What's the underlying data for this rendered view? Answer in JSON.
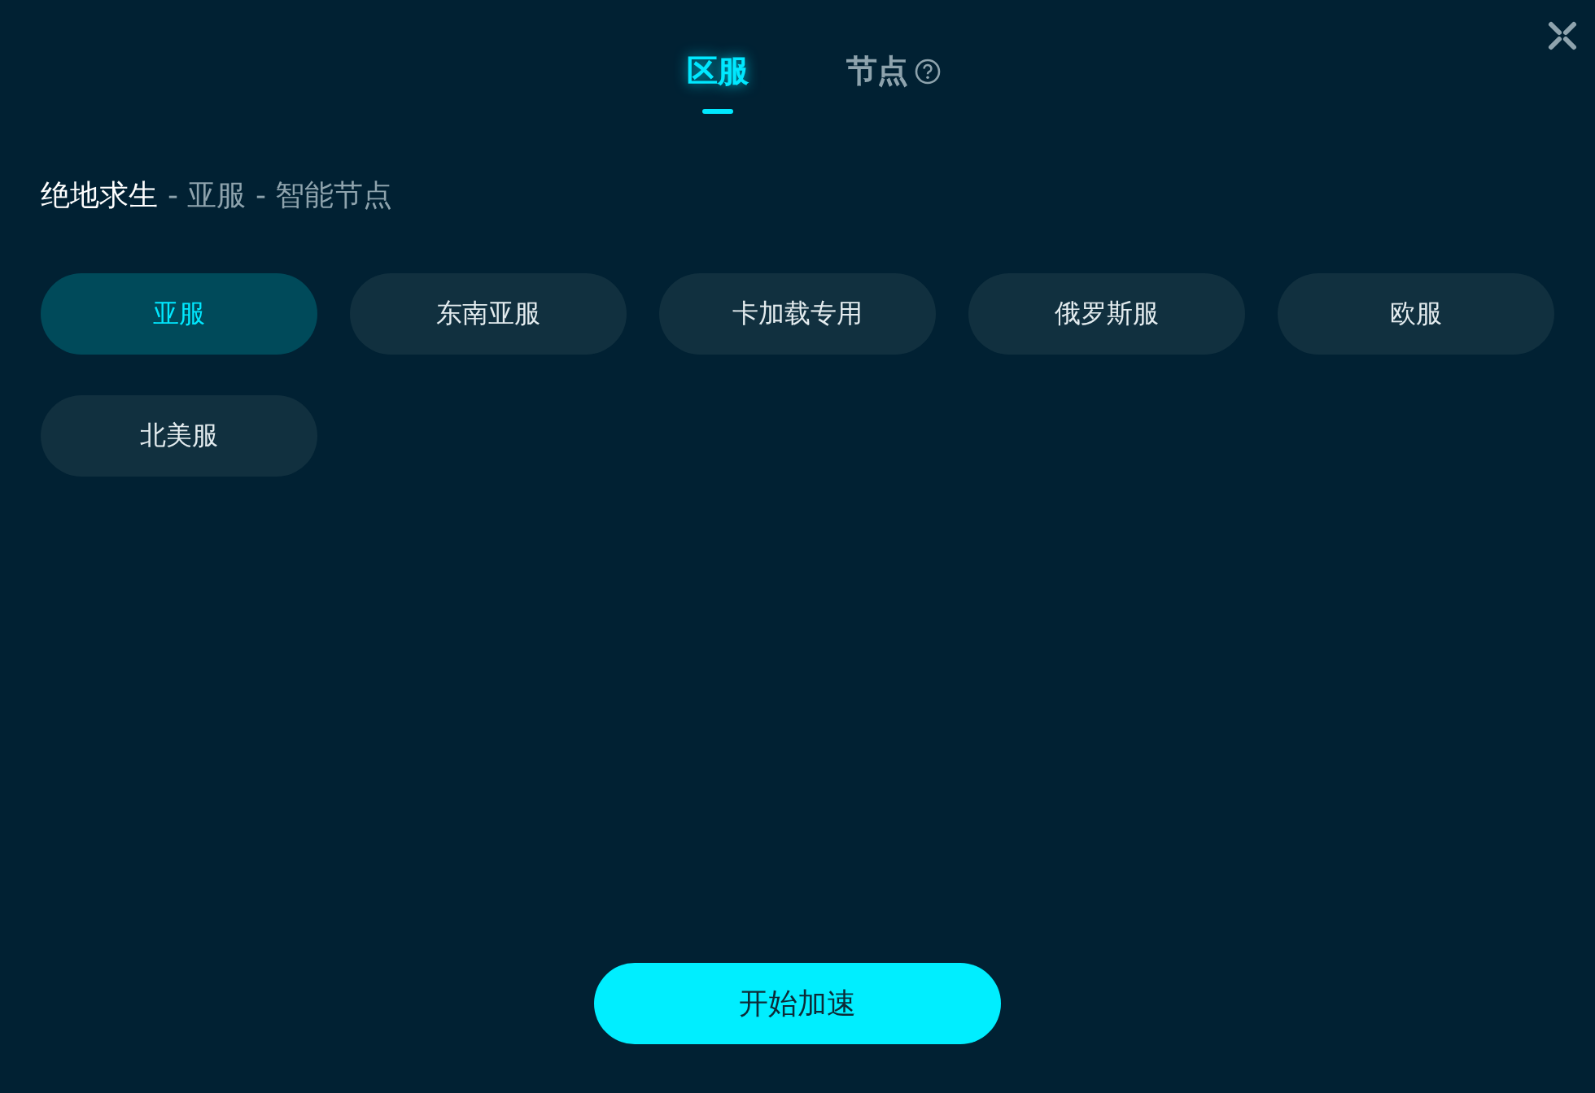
{
  "tabs": [
    {
      "label": "区服",
      "selected": true,
      "help": false
    },
    {
      "label": "节点",
      "selected": false,
      "help": true
    }
  ],
  "breadcrumb": {
    "game": "绝地求生",
    "path": "- 亚服 - 智能节点"
  },
  "regions": [
    {
      "label": "亚服",
      "selected": true
    },
    {
      "label": "东南亚服",
      "selected": false
    },
    {
      "label": "卡加载专用",
      "selected": false
    },
    {
      "label": "俄罗斯服",
      "selected": false
    },
    {
      "label": "欧服",
      "selected": false
    },
    {
      "label": "北美服",
      "selected": false
    }
  ],
  "start_button": "开始加速"
}
